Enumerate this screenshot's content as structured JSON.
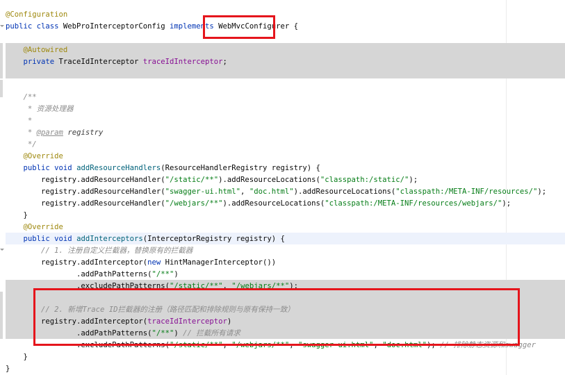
{
  "code_lines": [
    {
      "parts": [
        [
          "ann",
          "@Configuration"
        ]
      ]
    },
    {
      "parts": [
        [
          "kw",
          "public class "
        ],
        [
          "plain",
          "WebProInterceptorConfig "
        ],
        [
          "kw",
          "implements "
        ],
        [
          "plain",
          "WebMvcConfigurer "
        ],
        [
          "plain",
          "{"
        ]
      ]
    },
    {
      "parts": []
    },
    {
      "parts": [
        [
          "plain",
          "    "
        ],
        [
          "ann",
          "@Autowired"
        ]
      ]
    },
    {
      "parts": [
        [
          "plain",
          "    "
        ],
        [
          "kw",
          "private "
        ],
        [
          "plain",
          "TraceIdInterceptor "
        ],
        [
          "fld",
          "traceIdInterceptor"
        ],
        [
          "plain",
          ";"
        ]
      ]
    },
    {
      "parts": []
    },
    {
      "parts": []
    },
    {
      "parts": [
        [
          "plain",
          "    "
        ],
        [
          "doc",
          "/**"
        ]
      ]
    },
    {
      "parts": [
        [
          "plain",
          "     "
        ],
        [
          "doc",
          "* 资源处理器"
        ]
      ]
    },
    {
      "parts": [
        [
          "plain",
          "     "
        ],
        [
          "doc",
          "*"
        ]
      ]
    },
    {
      "parts": [
        [
          "plain",
          "     "
        ],
        [
          "doc",
          "* "
        ],
        [
          "doctag",
          "@param"
        ],
        [
          "param",
          " registry"
        ]
      ]
    },
    {
      "parts": [
        [
          "plain",
          "     "
        ],
        [
          "doc",
          "*/"
        ]
      ]
    },
    {
      "parts": [
        [
          "plain",
          "    "
        ],
        [
          "ann",
          "@Override"
        ]
      ]
    },
    {
      "parts": [
        [
          "plain",
          "    "
        ],
        [
          "kw",
          "public void "
        ],
        [
          "meth",
          "addResourceHandlers"
        ],
        [
          "plain",
          "(ResourceHandlerRegistry registry) {"
        ]
      ]
    },
    {
      "parts": [
        [
          "plain",
          "        registry.addResourceHandler("
        ],
        [
          "str",
          "\"/static/**\""
        ],
        [
          "plain",
          ").addResourceLocations("
        ],
        [
          "str",
          "\"classpath:/static/\""
        ],
        [
          "plain",
          ");"
        ]
      ]
    },
    {
      "parts": [
        [
          "plain",
          "        registry.addResourceHandler("
        ],
        [
          "str",
          "\"swagger-ui.html\""
        ],
        [
          "plain",
          ", "
        ],
        [
          "str",
          "\"doc.html\""
        ],
        [
          "plain",
          ").addResourceLocations("
        ],
        [
          "str",
          "\"classpath:/META-INF/resources/\""
        ],
        [
          "plain",
          ");"
        ]
      ]
    },
    {
      "parts": [
        [
          "plain",
          "        registry.addResourceHandler("
        ],
        [
          "str",
          "\"/webjars/**\""
        ],
        [
          "plain",
          ").addResourceLocations("
        ],
        [
          "str",
          "\"classpath:/META-INF/resources/webjars/\""
        ],
        [
          "plain",
          ");"
        ]
      ]
    },
    {
      "parts": [
        [
          "plain",
          "    }"
        ]
      ]
    },
    {
      "parts": [
        [
          "plain",
          "    "
        ],
        [
          "ann",
          "@Override"
        ]
      ]
    },
    {
      "parts": [
        [
          "plain",
          "    "
        ],
        [
          "kw",
          "public void "
        ],
        [
          "meth",
          "addInterceptors"
        ],
        [
          "plain",
          "(InterceptorRegistry registry) {"
        ]
      ]
    },
    {
      "parts": [
        [
          "plain",
          "        "
        ],
        [
          "cmt",
          "// 1. 注册自定义拦截器，替换原有的拦截器"
        ]
      ]
    },
    {
      "parts": [
        [
          "plain",
          "        registry.addInterceptor("
        ],
        [
          "kw",
          "new "
        ],
        [
          "plain",
          "HintManagerInterceptor())"
        ]
      ]
    },
    {
      "parts": [
        [
          "plain",
          "                .addPathPatterns("
        ],
        [
          "str",
          "\"/**\""
        ],
        [
          "plain",
          ")"
        ]
      ]
    },
    {
      "parts": [
        [
          "plain",
          "                .excludePathPatterns("
        ],
        [
          "str",
          "\"/static/**\""
        ],
        [
          "plain",
          ", "
        ],
        [
          "str",
          "\"/webjars/**\""
        ],
        [
          "plain",
          ");"
        ]
      ]
    },
    {
      "parts": []
    },
    {
      "parts": [
        [
          "plain",
          "        "
        ],
        [
          "cmt",
          "// 2. 新增Trace ID拦截器的注册（路径匹配和排除规则与原有保持一致）"
        ]
      ]
    },
    {
      "parts": [
        [
          "plain",
          "        registry.addInterceptor("
        ],
        [
          "fld",
          "traceIdInterceptor"
        ],
        [
          "plain",
          ")"
        ]
      ]
    },
    {
      "parts": [
        [
          "plain",
          "                .addPathPatterns("
        ],
        [
          "str",
          "\"/**\""
        ],
        [
          "plain",
          ") "
        ],
        [
          "cmt",
          "// 拦截所有请求"
        ]
      ]
    },
    {
      "parts": [
        [
          "plain",
          "                .excludePathPatterns("
        ],
        [
          "str",
          "\"/static/**\""
        ],
        [
          "plain",
          ", "
        ],
        [
          "str",
          "\"/webjars/**\""
        ],
        [
          "plain",
          ", "
        ],
        [
          "str",
          "\"swagger-ui.html\""
        ],
        [
          "plain",
          ", "
        ],
        [
          "str",
          "\"doc.html\""
        ],
        [
          "plain",
          "); "
        ],
        [
          "cmt",
          "// 排除静态资源和swagger"
        ]
      ]
    },
    {
      "parts": [
        [
          "plain",
          "    }"
        ]
      ]
    },
    {
      "parts": [
        [
          "plain",
          "}"
        ]
      ]
    }
  ]
}
